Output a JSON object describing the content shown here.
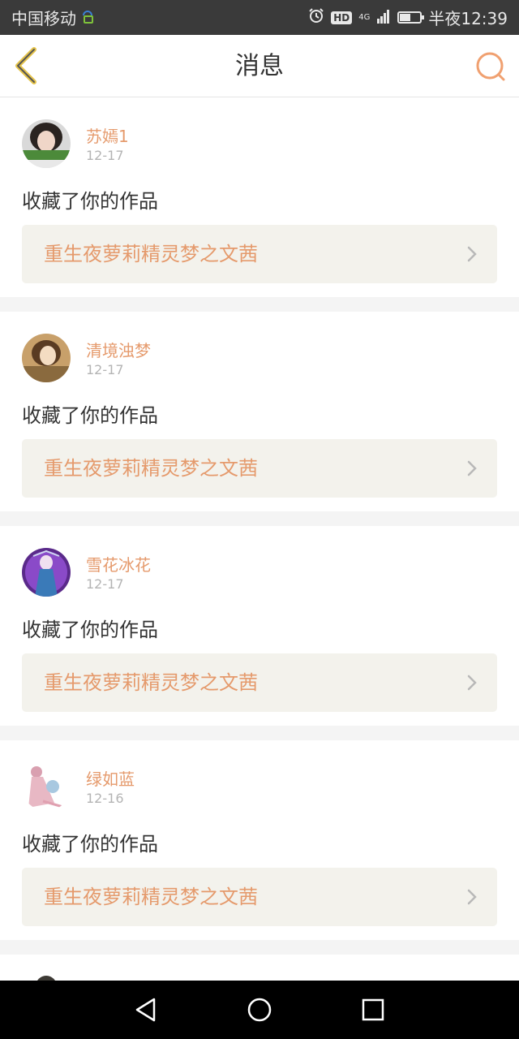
{
  "status_bar": {
    "carrier": "中国移动",
    "network": "4G",
    "hd": "HD",
    "time": "半夜12:39",
    "battery_level": 0.55
  },
  "header": {
    "title": "消息",
    "accent_color": "#e59a6c"
  },
  "notifications": [
    {
      "username": "苏嫣1",
      "date": "12-17",
      "action": "收藏了你的作品",
      "work_title": "重生夜萝莉精灵梦之文茜"
    },
    {
      "username": "清境浊梦",
      "date": "12-17",
      "action": "收藏了你的作品",
      "work_title": "重生夜萝莉精灵梦之文茜"
    },
    {
      "username": "雪花冰花",
      "date": "12-17",
      "action": "收藏了你的作品",
      "work_title": "重生夜萝莉精灵梦之文茜"
    },
    {
      "username": "绿如蓝",
      "date": "12-16",
      "action": "收藏了你的作品",
      "work_title": "重生夜萝莉精灵梦之文茜"
    }
  ],
  "nav": {
    "back_icon": "triangle-back-icon",
    "home_icon": "circle-home-icon",
    "recents_icon": "square-recents-icon"
  }
}
